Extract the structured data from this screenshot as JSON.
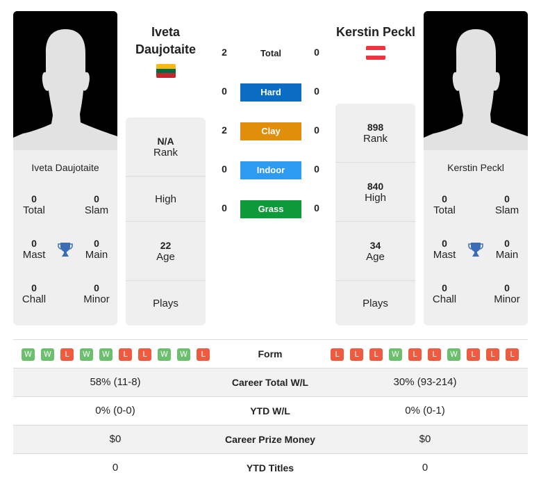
{
  "player1": {
    "name": "Iveta Daujotaite",
    "name_line1": "Iveta",
    "name_line2": "Daujotaite",
    "flag": "lithuania-flag",
    "flag_colors": [
      "#FDB913",
      "#006A44",
      "#C1272D"
    ],
    "card_name": "Iveta Daujotaite",
    "titles": {
      "total": {
        "value": "0",
        "label": "Total"
      },
      "slam": {
        "value": "0",
        "label": "Slam"
      },
      "mast": {
        "value": "0",
        "label": "Mast"
      },
      "main": {
        "value": "0",
        "label": "Main"
      },
      "chall": {
        "value": "0",
        "label": "Chall"
      },
      "minor": {
        "value": "0",
        "label": "Minor"
      }
    },
    "info": {
      "rank": {
        "value": "N/A",
        "label": "Rank"
      },
      "high": {
        "value": "",
        "label": "High"
      },
      "age": {
        "value": "22",
        "label": "Age"
      },
      "plays": {
        "value": "",
        "label": "Plays"
      }
    },
    "form": [
      "W",
      "W",
      "L",
      "W",
      "W",
      "L",
      "L",
      "W",
      "W",
      "L"
    ]
  },
  "player2": {
    "name": "Kerstin Peckl",
    "flag": "austria-flag",
    "flag_colors": [
      "#EF3340",
      "#FFFFFF",
      "#EF3340"
    ],
    "card_name": "Kerstin Peckl",
    "titles": {
      "total": {
        "value": "0",
        "label": "Total"
      },
      "slam": {
        "value": "0",
        "label": "Slam"
      },
      "mast": {
        "value": "0",
        "label": "Mast"
      },
      "main": {
        "value": "0",
        "label": "Main"
      },
      "chall": {
        "value": "0",
        "label": "Chall"
      },
      "minor": {
        "value": "0",
        "label": "Minor"
      }
    },
    "info": {
      "rank": {
        "value": "898",
        "label": "Rank"
      },
      "high": {
        "value": "840",
        "label": "High"
      },
      "age": {
        "value": "34",
        "label": "Age"
      },
      "plays": {
        "value": "",
        "label": "Plays"
      }
    },
    "form": [
      "L",
      "L",
      "L",
      "W",
      "L",
      "L",
      "W",
      "L",
      "L",
      "L"
    ]
  },
  "h2h": {
    "total": {
      "label": "Total",
      "p1": "2",
      "p2": "0"
    },
    "surfaces": [
      {
        "label": "Hard",
        "p1": "0",
        "p2": "0",
        "color": "#0A6CC2"
      },
      {
        "label": "Clay",
        "p1": "2",
        "p2": "0",
        "color": "#E08E0B"
      },
      {
        "label": "Indoor",
        "p1": "0",
        "p2": "0",
        "color": "#2E9BF0"
      },
      {
        "label": "Grass",
        "p1": "0",
        "p2": "0",
        "color": "#0E9A3B"
      }
    ]
  },
  "form_label": "Form",
  "form_colors": {
    "W": "#6CBF6C",
    "L": "#EE5B40"
  },
  "comparison": [
    {
      "label": "Career Total W/L",
      "p1": "58% (11-8)",
      "p2": "30% (93-214)"
    },
    {
      "label": "YTD W/L",
      "p1": "0% (0-0)",
      "p2": "0% (0-1)"
    },
    {
      "label": "Career Prize Money",
      "p1": "$0",
      "p2": "$0"
    },
    {
      "label": "YTD Titles",
      "p1": "0",
      "p2": "0"
    }
  ],
  "trophy_color": "#3A6DB5"
}
